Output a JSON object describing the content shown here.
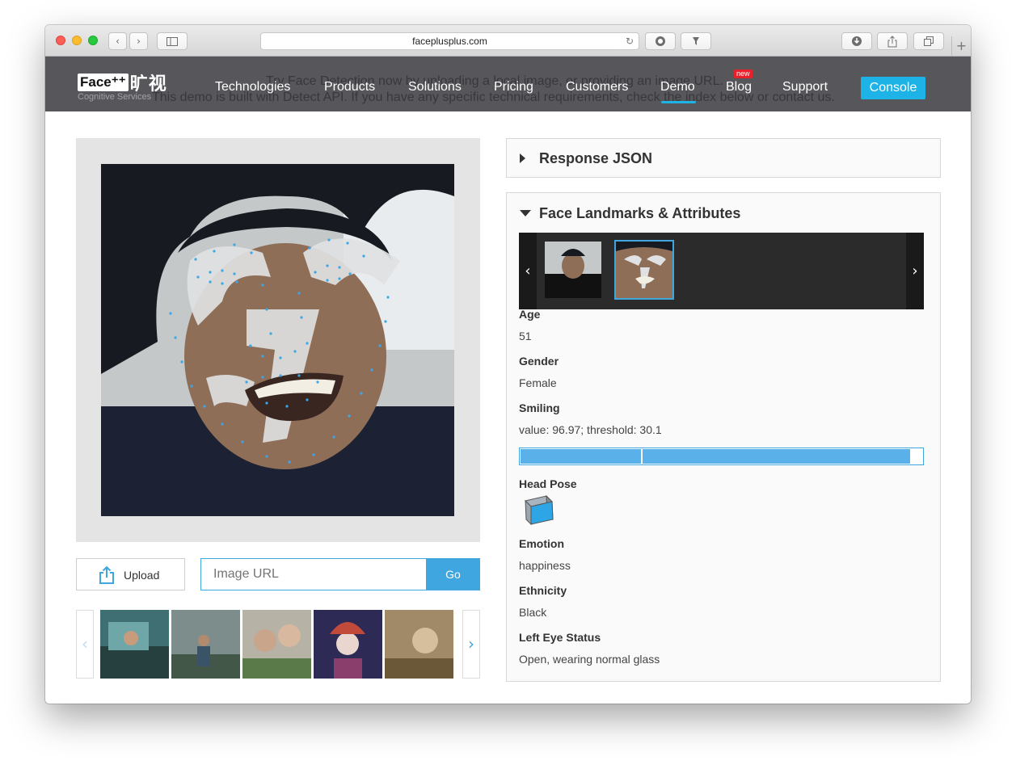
{
  "browser": {
    "url": "faceplusplus.com",
    "back_glyph": "‹",
    "forward_glyph": "›",
    "reload_glyph": "↻",
    "newtab_glyph": "+"
  },
  "header": {
    "logo_face": "Face⁺⁺",
    "logo_cn": "旷视",
    "logo_sub": "Cognitive Services",
    "bg_line1": "Try Face Detection now by uploading a local image, or providing an image URL.",
    "bg_line2": "This demo is built with Detect API. If you have any specific technical requirements, check the index below or contact us.",
    "nav": [
      "Technologies",
      "Products",
      "Solutions",
      "Pricing",
      "Customers",
      "Demo",
      "Blog",
      "Support"
    ],
    "active_nav": "Demo",
    "new_badge": "new",
    "console": "Console",
    "accent_color": "#1eb3e6",
    "header_color": "#56565b"
  },
  "left": {
    "upload_label": "Upload",
    "url_placeholder": "Image URL",
    "go_label": "Go",
    "prev_glyph": "‹",
    "next_glyph": "›"
  },
  "right": {
    "response_json_title": "Response JSON",
    "landmarks_title": "Face Landmarks & Attributes",
    "strip_prev": "‹",
    "strip_next": "›",
    "attributes": {
      "age_label": "Age",
      "age_value": "51",
      "gender_label": "Gender",
      "gender_value": "Female",
      "smiling_label": "Smiling",
      "smiling_value": "value: 96.97; threshold: 30.1",
      "head_pose_label": "Head Pose",
      "emotion_label": "Emotion",
      "emotion_value": "happiness",
      "ethnicity_label": "Ethnicity",
      "ethnicity_value": "Black",
      "left_eye_label": "Left Eye Status",
      "left_eye_value": "Open, wearing normal glass"
    },
    "smile": {
      "value": 96.97,
      "threshold": 30.1,
      "max": 100,
      "color": "#5ab1ea"
    }
  }
}
